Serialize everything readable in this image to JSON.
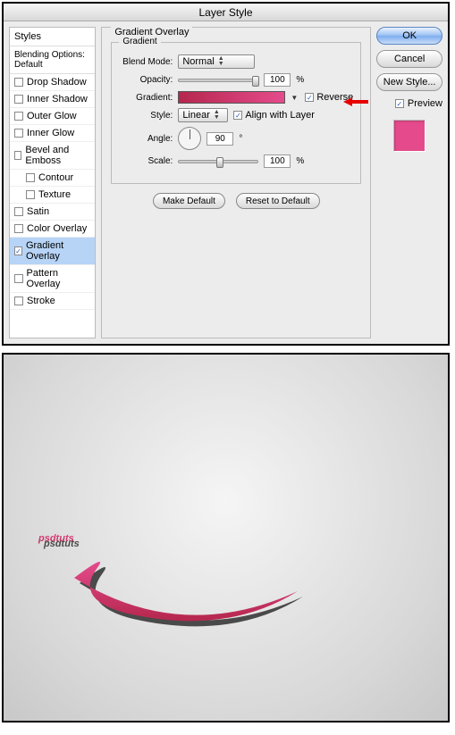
{
  "window": {
    "title": "Layer Style"
  },
  "styles_panel": {
    "header": "Styles",
    "subheader": "Blending Options: Default",
    "items": [
      {
        "label": "Drop Shadow",
        "checked": false
      },
      {
        "label": "Inner Shadow",
        "checked": false
      },
      {
        "label": "Outer Glow",
        "checked": false
      },
      {
        "label": "Inner Glow",
        "checked": false
      },
      {
        "label": "Bevel and Emboss",
        "checked": false
      },
      {
        "label": "Contour",
        "checked": false,
        "indent": true
      },
      {
        "label": "Texture",
        "checked": false,
        "indent": true
      },
      {
        "label": "Satin",
        "checked": false
      },
      {
        "label": "Color Overlay",
        "checked": false
      },
      {
        "label": "Gradient Overlay",
        "checked": true,
        "selected": true
      },
      {
        "label": "Pattern Overlay",
        "checked": false
      },
      {
        "label": "Stroke",
        "checked": false
      }
    ]
  },
  "gradient_overlay": {
    "panel_title": "Gradient Overlay",
    "group_title": "Gradient",
    "blend_mode_label": "Blend Mode:",
    "blend_mode_value": "Normal",
    "opacity_label": "Opacity:",
    "opacity_value": "100",
    "opacity_unit": "%",
    "gradient_label": "Gradient:",
    "gradient_start": "#b5274e",
    "gradient_end": "#e54b8c",
    "reverse_label": "Reverse",
    "reverse_checked": true,
    "style_label": "Style:",
    "style_value": "Linear",
    "align_label": "Align with Layer",
    "align_checked": true,
    "angle_label": "Angle:",
    "angle_value": "90",
    "angle_unit": "°",
    "scale_label": "Scale:",
    "scale_value": "100",
    "scale_unit": "%",
    "make_default": "Make Default",
    "reset_default": "Reset to Default"
  },
  "right": {
    "ok": "OK",
    "cancel": "Cancel",
    "new_style": "New Style...",
    "preview_label": "Preview",
    "preview_checked": true,
    "preview_color": "#e54b8c"
  },
  "result": {
    "text": "psdtuts",
    "fill": "#d33572",
    "shadow": "#4a4a4a"
  }
}
